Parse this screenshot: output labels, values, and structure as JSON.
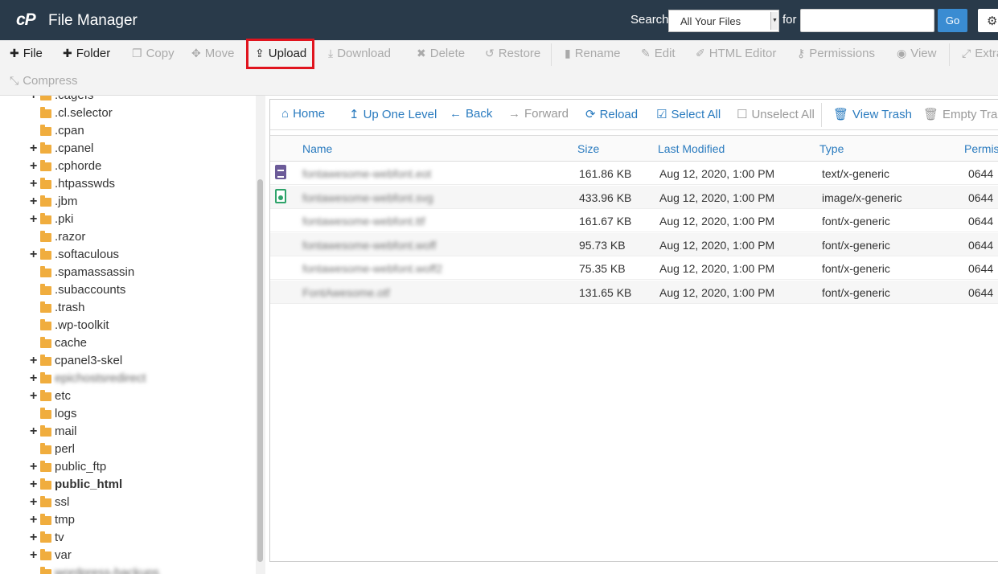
{
  "header": {
    "logo": "cP",
    "title": "File Manager",
    "search_label": "Search",
    "search_scope": "All Your Files",
    "for_label": "for",
    "search_query": "",
    "go_label": "Go"
  },
  "toolbar": {
    "file": "File",
    "folder": "Folder",
    "copy": "Copy",
    "move": "Move",
    "upload": "Upload",
    "download": "Download",
    "delete": "Delete",
    "restore": "Restore",
    "rename": "Rename",
    "edit": "Edit",
    "html_editor": "HTML Editor",
    "permissions": "Permissions",
    "view": "View",
    "extract": "Extra",
    "compress": "Compress"
  },
  "tree": [
    {
      "label": ".cagefs",
      "plus": true
    },
    {
      "label": ".cl.selector",
      "plus": false
    },
    {
      "label": ".cpan",
      "plus": false
    },
    {
      "label": ".cpanel",
      "plus": true
    },
    {
      "label": ".cphorde",
      "plus": true
    },
    {
      "label": ".htpasswds",
      "plus": true
    },
    {
      "label": ".jbm",
      "plus": true
    },
    {
      "label": ".pki",
      "plus": true
    },
    {
      "label": ".razor",
      "plus": false
    },
    {
      "label": ".softaculous",
      "plus": true
    },
    {
      "label": ".spamassassin",
      "plus": false
    },
    {
      "label": ".subaccounts",
      "plus": false
    },
    {
      "label": ".trash",
      "plus": false
    },
    {
      "label": ".wp-toolkit",
      "plus": false
    },
    {
      "label": "cache",
      "plus": false
    },
    {
      "label": "cpanel3-skel",
      "plus": true
    },
    {
      "label": "epichostsredirect",
      "plus": true,
      "blurred": true
    },
    {
      "label": "etc",
      "plus": true
    },
    {
      "label": "logs",
      "plus": false
    },
    {
      "label": "mail",
      "plus": true
    },
    {
      "label": "perl",
      "plus": false
    },
    {
      "label": "public_ftp",
      "plus": true
    },
    {
      "label": "public_html",
      "plus": true,
      "bold": true
    },
    {
      "label": "ssl",
      "plus": true
    },
    {
      "label": "tmp",
      "plus": true
    },
    {
      "label": "tv",
      "plus": true
    },
    {
      "label": "var",
      "plus": true
    },
    {
      "label": "wordpress-backups",
      "plus": false,
      "blurred": true
    }
  ],
  "nav": {
    "home": "Home",
    "up_one_level": "Up One Level",
    "back": "Back",
    "forward": "Forward",
    "reload": "Reload",
    "select_all": "Select All",
    "unselect_all": "Unselect All",
    "view_trash": "View Trash",
    "empty_trash": "Empty Trash"
  },
  "table": {
    "columns": [
      "Name",
      "Size",
      "Last Modified",
      "Type",
      "Permis"
    ],
    "rows": [
      {
        "name": "fontawesome-webfont.eot",
        "size": "161.86 KB",
        "modified": "Aug 12, 2020, 1:00 PM",
        "type": "text/x-generic",
        "perms": "0644",
        "icon": "text"
      },
      {
        "name": "fontawesome-webfont.svg",
        "size": "433.96 KB",
        "modified": "Aug 12, 2020, 1:00 PM",
        "type": "image/x-generic",
        "perms": "0644",
        "icon": "image"
      },
      {
        "name": "fontawesome-webfont.ttf",
        "size": "161.67 KB",
        "modified": "Aug 12, 2020, 1:00 PM",
        "type": "font/x-generic",
        "perms": "0644",
        "icon": "none"
      },
      {
        "name": "fontawesome-webfont.woff",
        "size": "95.73 KB",
        "modified": "Aug 12, 2020, 1:00 PM",
        "type": "font/x-generic",
        "perms": "0644",
        "icon": "none"
      },
      {
        "name": "fontawesome-webfont.woff2",
        "size": "75.35 KB",
        "modified": "Aug 12, 2020, 1:00 PM",
        "type": "font/x-generic",
        "perms": "0644",
        "icon": "none"
      },
      {
        "name": "FontAwesome.otf",
        "size": "131.65 KB",
        "modified": "Aug 12, 2020, 1:00 PM",
        "type": "font/x-generic",
        "perms": "0644",
        "icon": "none"
      }
    ]
  }
}
